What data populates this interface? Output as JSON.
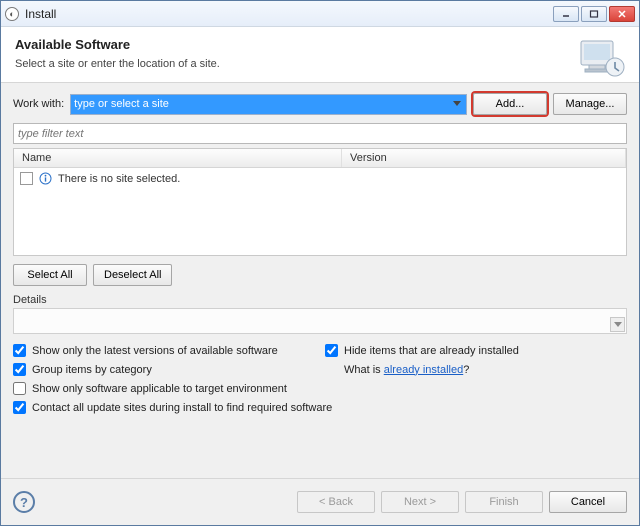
{
  "window": {
    "title": "Install"
  },
  "header": {
    "title": "Available Software",
    "subtitle": "Select a site or enter the location of a site."
  },
  "workwith": {
    "label": "Work with:",
    "placeholder": "type or select a site",
    "add": "Add...",
    "manage": "Manage..."
  },
  "filter": {
    "placeholder": "type filter text"
  },
  "table": {
    "col_name": "Name",
    "col_version": "Version",
    "empty_msg": "There is no site selected."
  },
  "selbtns": {
    "select_all": "Select All",
    "deselect_all": "Deselect All"
  },
  "details": {
    "label": "Details"
  },
  "options": {
    "latest": {
      "label": "Show only the latest versions of available software",
      "checked": true
    },
    "group": {
      "label": "Group items by category",
      "checked": true
    },
    "applicable": {
      "label": "Show only software applicable to target environment",
      "checked": false
    },
    "contact": {
      "label": "Contact all update sites during install to find required software",
      "checked": true
    },
    "hide": {
      "label": "Hide items that are already installed",
      "checked": true
    },
    "whatis_prefix": "What is ",
    "whatis_link": "already installed",
    "whatis_suffix": "?"
  },
  "footer": {
    "back": "< Back",
    "next": "Next >",
    "finish": "Finish",
    "cancel": "Cancel"
  }
}
